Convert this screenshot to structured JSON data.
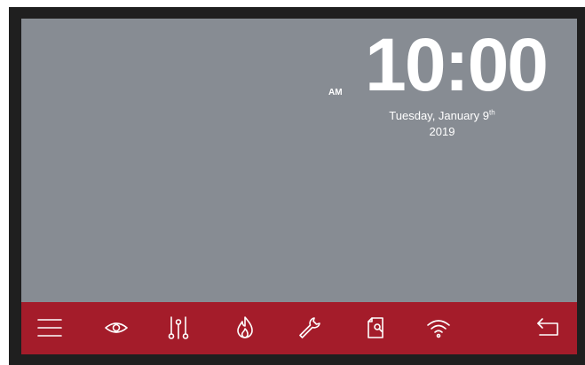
{
  "clock": {
    "time": "10:00",
    "ampm": "AM",
    "date_line": "Tuesday, January 9",
    "date_suffix": "th",
    "year": "2019"
  },
  "colors": {
    "screen_bg": "#878c93",
    "toolbar_bg": "#a41c2a",
    "bezel": "#1f1f1f",
    "text": "#ffffff"
  },
  "toolbar": {
    "buttons": [
      {
        "icon": "menu-icon"
      },
      {
        "icon": "eye-icon"
      },
      {
        "icon": "sliders-icon"
      },
      {
        "icon": "flame-icon"
      },
      {
        "icon": "wrench-icon"
      },
      {
        "icon": "document-search-icon"
      },
      {
        "icon": "wifi-icon"
      },
      {
        "icon": "back-arrow-icon"
      }
    ]
  }
}
